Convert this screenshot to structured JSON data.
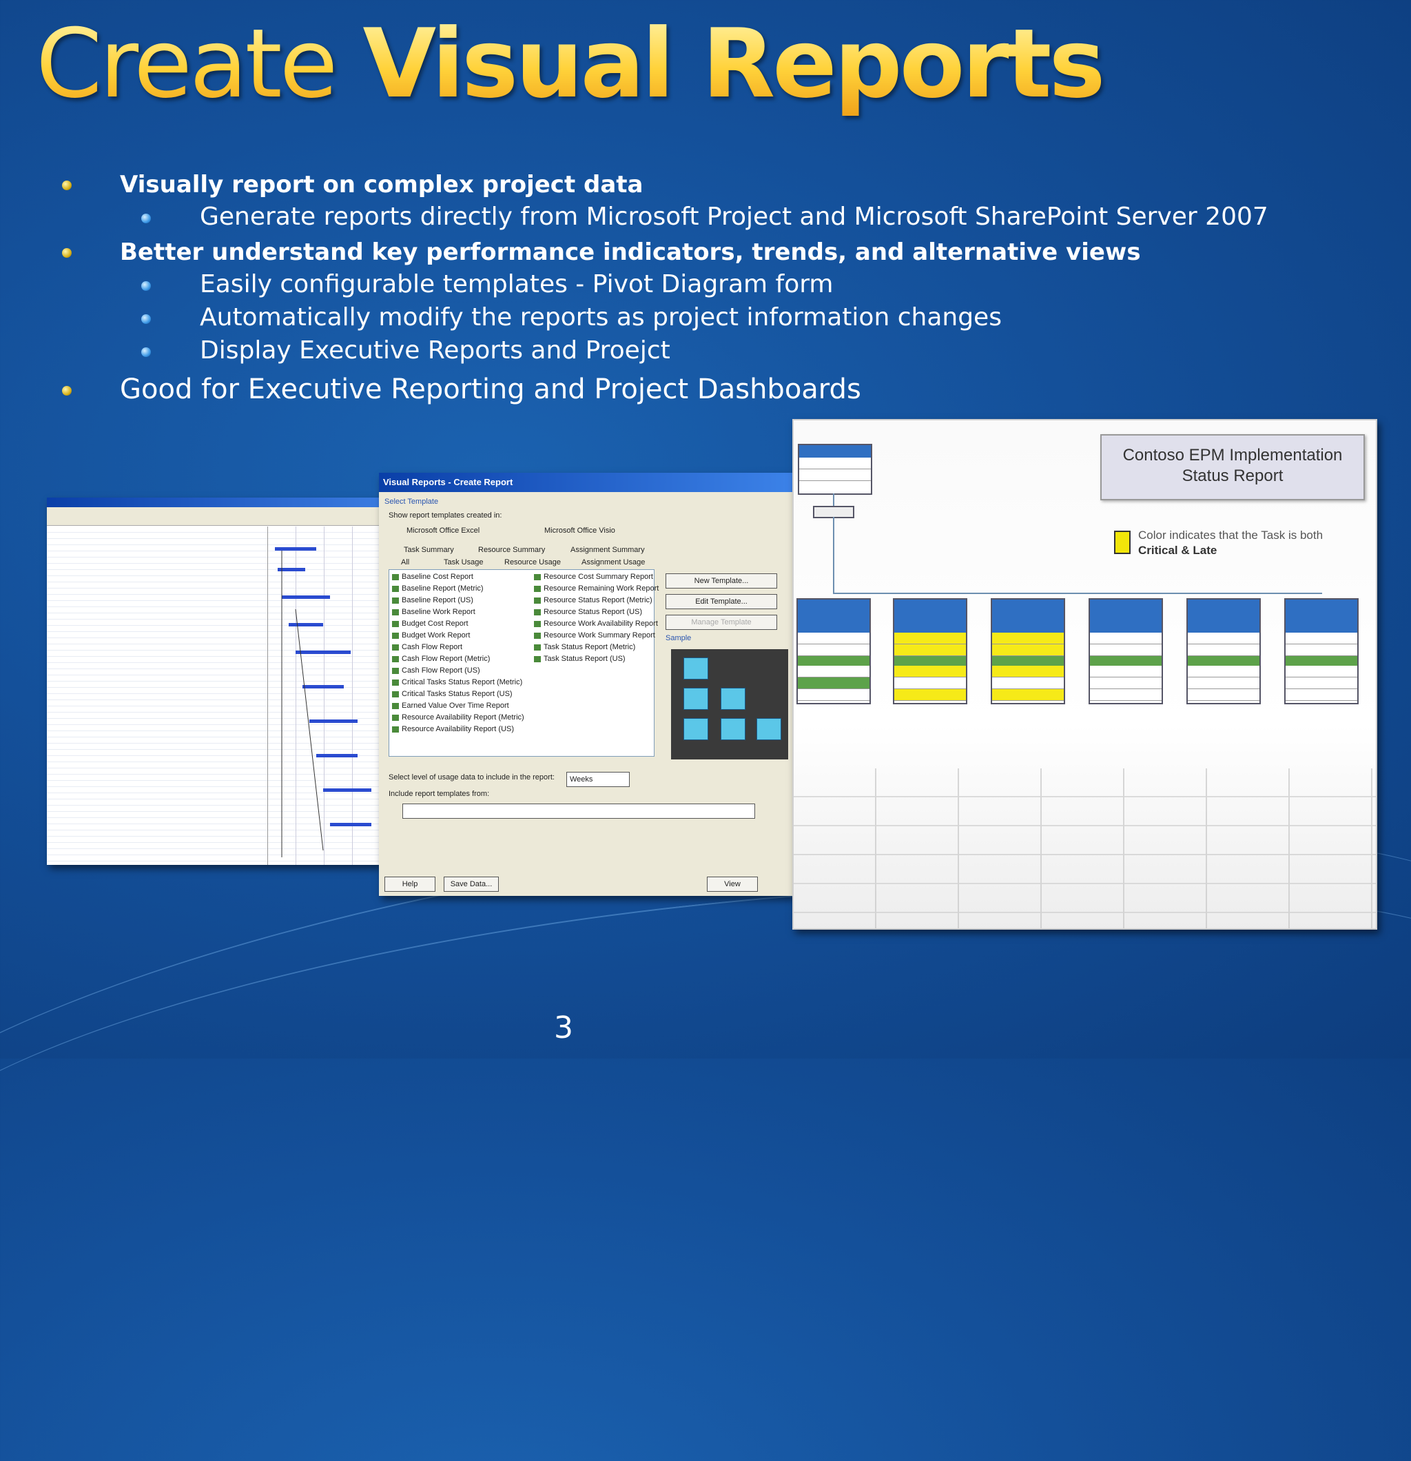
{
  "slide": {
    "title_light": "Create",
    "title_bold": "Visual Reports",
    "page_number": "3",
    "bullets": [
      {
        "level": 1,
        "bold": true,
        "text": "Visually report on complex project data"
      },
      {
        "level": 2,
        "bold": false,
        "text": "Generate reports directly from Microsoft Project and Microsoft SharePoint Server 2007"
      },
      {
        "level": 1,
        "bold": true,
        "text": "Better understand key performance indicators, trends, and alternative views"
      },
      {
        "level": 2,
        "bold": false,
        "text": "Easily configurable templates - Pivot Diagram form"
      },
      {
        "level": 2,
        "bold": false,
        "text": "Automatically modify the reports as project information changes"
      },
      {
        "level": 2,
        "bold": false,
        "text": "Display Executive Reports and Proejct"
      },
      {
        "level": 1,
        "bold": false,
        "text": "Good for Executive Reporting and Project Dashboards"
      }
    ]
  },
  "dialog": {
    "title": "Visual Reports - Create Report",
    "select_template": "Select Template",
    "show_templates": "Show report templates created in:",
    "opt_excel": "Microsoft Office Excel",
    "opt_visio": "Microsoft Office Visio",
    "tabs_row1": [
      "Task Summary",
      "Resource Summary",
      "Assignment Summary"
    ],
    "tabs_row2": [
      "All",
      "Task Usage",
      "Resource Usage",
      "Assignment Usage"
    ],
    "reports_left": [
      "Baseline Cost Report",
      "Baseline Report (Metric)",
      "Baseline Report (US)",
      "Baseline Work Report",
      "Budget Cost Report",
      "Budget Work Report",
      "Cash Flow Report",
      "Cash Flow Report (Metric)",
      "Cash Flow Report (US)",
      "Critical Tasks Status Report (Metric)",
      "Critical Tasks Status Report (US)",
      "Earned Value Over Time Report",
      "Resource Availability Report (Metric)",
      "Resource Availability Report (US)"
    ],
    "reports_right": [
      "Resource Cost Summary Report",
      "Resource Remaining Work Report",
      "Resource Status Report (Metric)",
      "Resource Status Report (US)",
      "Resource Work Availability Report",
      "Resource Work Summary Report",
      "Task Status Report (Metric)",
      "Task Status Report (US)"
    ],
    "btn_new_template": "New Template...",
    "btn_edit_template": "Edit Template...",
    "btn_manage_template": "Manage Template",
    "sample_label": "Sample",
    "usage_label": "Select level of usage data to include in the report:",
    "usage_value": "Weeks",
    "include_label": "Include report templates from:",
    "btn_help": "Help",
    "btn_save_data": "Save Data...",
    "btn_view": "View"
  },
  "visio": {
    "report_title_line1": "Contoso EPM Implementation",
    "report_title_line2": "Status Report",
    "legend_text": "Color indicates that the Task is both",
    "legend_bold": "Critical & Late"
  },
  "colors": {
    "title_gold": "#ffd23a",
    "background_blue": "#14509a",
    "critical_late_yellow": "#f2e60a"
  }
}
